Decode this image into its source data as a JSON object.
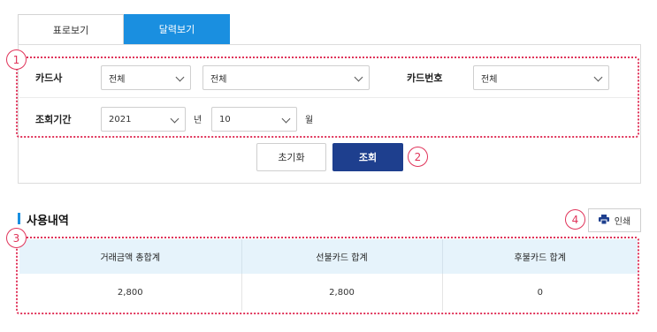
{
  "tabs": {
    "table_view": "표로보기",
    "calendar_view": "달력보기"
  },
  "search": {
    "card_company_label": "카드사",
    "card_company_value": "전체",
    "card_company_sub_value": "전체",
    "card_number_label": "카드번호",
    "card_number_value": "전체",
    "period_label": "조회기간",
    "year_value": "2021",
    "year_unit": "년",
    "month_value": "10",
    "month_unit": "월"
  },
  "buttons": {
    "reset_label": "초기화",
    "search_label": "조회",
    "print_label": "인쇄"
  },
  "markers": [
    "1",
    "2",
    "3",
    "4"
  ],
  "usage": {
    "section_title": "사용내역",
    "columns": [
      "거래금액 총합계",
      "선불카드 합계",
      "후불카드 합계"
    ],
    "row": [
      "2,800",
      "2,800",
      "0"
    ]
  },
  "colors": {
    "accent_blue": "#1a8fe0",
    "search_button": "#1e3f8e",
    "marker_red": "#e0345a",
    "table_header": "#e6f3fb"
  }
}
